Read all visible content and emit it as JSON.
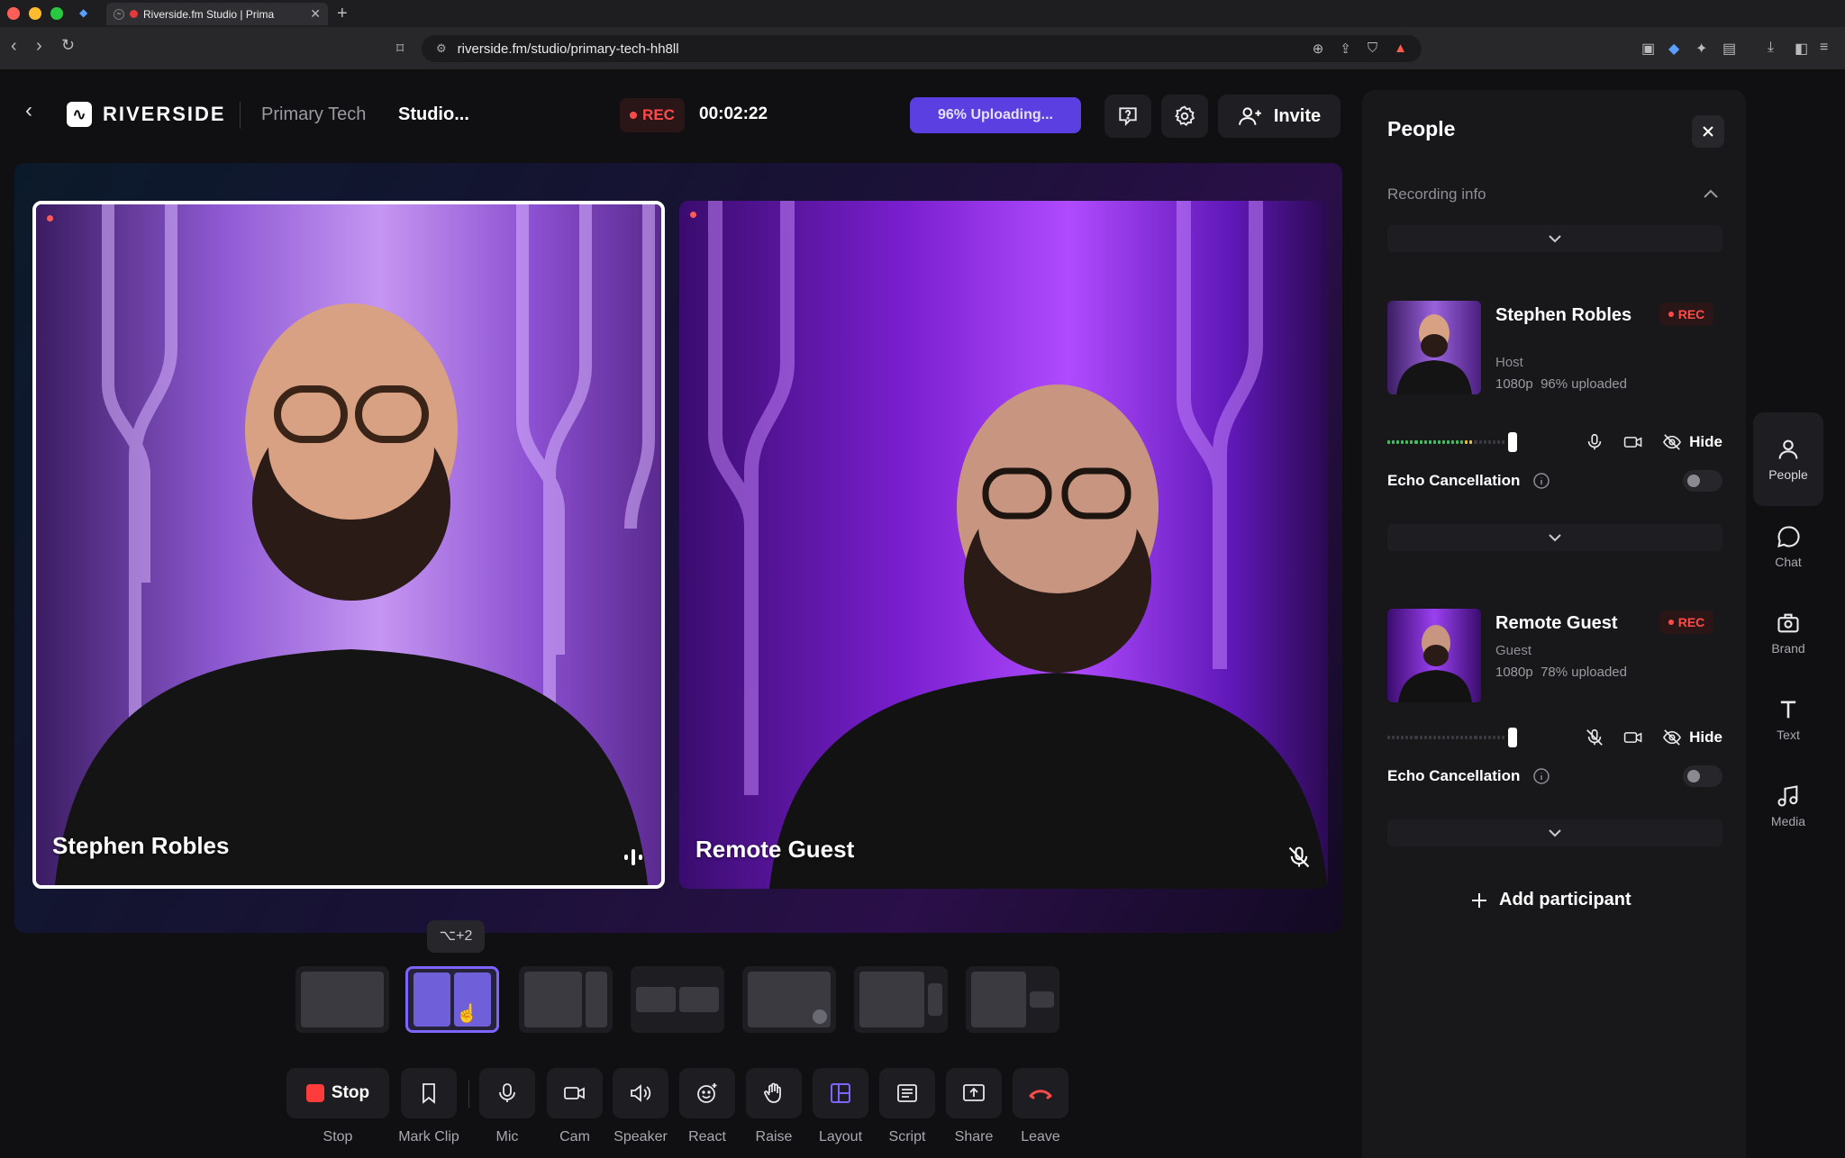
{
  "browser": {
    "tab_title": "Riverside.fm Studio | Prima",
    "url": "riverside.fm/studio/primary-tech-hh8ll"
  },
  "header": {
    "brand": "RIVERSIDE",
    "team": "Primary Tech",
    "studio": "Studio...",
    "rec_label": "REC",
    "timer": "00:02:22",
    "upload_status": "96% Uploading...",
    "invite_label": "Invite"
  },
  "stage": {
    "tiles": [
      {
        "name": "Stephen Robles",
        "speaking": true
      },
      {
        "name": "Remote Guest",
        "muted": true
      }
    ]
  },
  "layouts": {
    "shortcut": "⌥+2",
    "selected_index": 1
  },
  "toolbar": {
    "stop": "Stop",
    "items": [
      {
        "label": "Stop"
      },
      {
        "label": "Mark Clip"
      },
      {
        "label": "Mic"
      },
      {
        "label": "Cam"
      },
      {
        "label": "Speaker"
      },
      {
        "label": "React"
      },
      {
        "label": "Raise"
      },
      {
        "label": "Layout"
      },
      {
        "label": "Script"
      },
      {
        "label": "Share"
      },
      {
        "label": "Leave"
      }
    ]
  },
  "panel": {
    "title": "People",
    "recording_info": "Recording info",
    "people": [
      {
        "name": "Stephen Robles",
        "role": "Host",
        "resolution": "1080p",
        "uploaded": "96% uploaded",
        "rec": "REC",
        "hide": "Hide",
        "echo": "Echo Cancellation"
      },
      {
        "name": "Remote Guest",
        "role": "Guest",
        "resolution": "1080p",
        "uploaded": "78% uploaded",
        "rec": "REC",
        "hide": "Hide",
        "echo": "Echo Cancellation"
      }
    ],
    "add_participant": "Add participant"
  },
  "rail": [
    {
      "label": "People"
    },
    {
      "label": "Chat"
    },
    {
      "label": "Brand"
    },
    {
      "label": "Text"
    },
    {
      "label": "Media"
    }
  ],
  "colors": {
    "accent": "#5b3fe0",
    "rec": "#ff4a4a",
    "selected_layout": "#7c64ff"
  }
}
